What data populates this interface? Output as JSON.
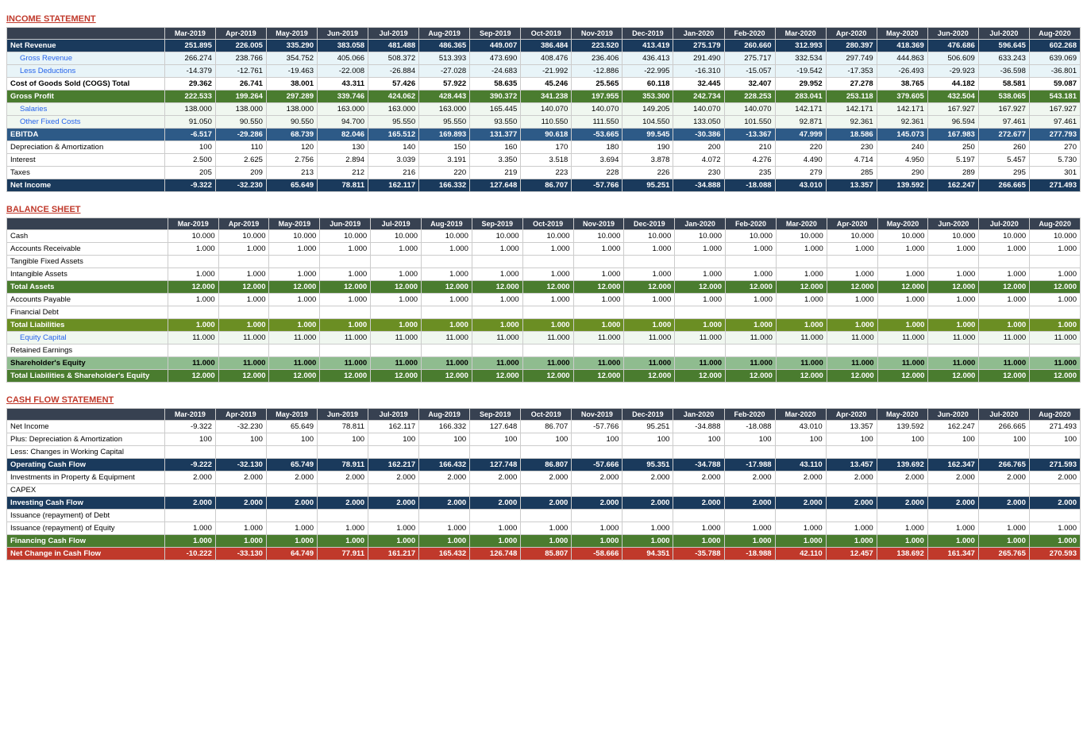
{
  "income": {
    "title": "INCOME STATEMENT",
    "columns": [
      "",
      "Mar-2019",
      "Apr-2019",
      "May-2019",
      "Jun-2019",
      "Jul-2019",
      "Aug-2019",
      "Sep-2019",
      "Oct-2019",
      "Nov-2019",
      "Dec-2019",
      "Jan-2020",
      "Feb-2020",
      "Mar-2020",
      "Apr-2020",
      "May-2020",
      "Jun-2020",
      "Jul-2020",
      "Aug-2020"
    ],
    "rows": [
      {
        "label": "Net Revenue",
        "style": "header-blue",
        "vals": [
          "251.895",
          "226.005",
          "335.290",
          "383.058",
          "481.488",
          "486.365",
          "449.007",
          "386.484",
          "223.520",
          "413.419",
          "275.179",
          "260.660",
          "312.993",
          "280.397",
          "418.369",
          "476.686",
          "596.645",
          "602.268"
        ]
      },
      {
        "label": "Gross Revenue",
        "style": "indent",
        "vals": [
          "266.274",
          "238.766",
          "354.752",
          "405.066",
          "508.372",
          "513.393",
          "473.690",
          "408.476",
          "236.406",
          "436.413",
          "291.490",
          "275.717",
          "332.534",
          "297.749",
          "444.863",
          "506.609",
          "633.243",
          "639.069"
        ]
      },
      {
        "label": "Less Deductions",
        "style": "indent",
        "vals": [
          "-14.379",
          "-12.761",
          "-19.463",
          "-22.008",
          "-26.884",
          "-27.028",
          "-24.683",
          "-21.992",
          "-12.886",
          "-22.995",
          "-16.310",
          "-15.057",
          "-19.542",
          "-17.353",
          "-26.493",
          "-29.923",
          "-36.598",
          "-36.801"
        ]
      },
      {
        "label": "Cost of Goods Sold (COGS) Total",
        "style": "cogs",
        "vals": [
          "29.362",
          "26.741",
          "38.001",
          "43.311",
          "57.426",
          "57.922",
          "58.635",
          "45.246",
          "25.565",
          "60.118",
          "32.445",
          "32.407",
          "29.952",
          "27.278",
          "38.765",
          "44.182",
          "58.581",
          "59.087"
        ]
      },
      {
        "label": "Gross Profit",
        "style": "green",
        "vals": [
          "222.533",
          "199.264",
          "297.289",
          "339.746",
          "424.062",
          "428.443",
          "390.372",
          "341.238",
          "197.955",
          "353.300",
          "242.734",
          "228.253",
          "283.041",
          "253.118",
          "379.605",
          "432.504",
          "538.065",
          "543.181"
        ]
      },
      {
        "label": "Salaries",
        "style": "indent2",
        "vals": [
          "138.000",
          "138.000",
          "138.000",
          "163.000",
          "163.000",
          "163.000",
          "165.445",
          "140.070",
          "140.070",
          "149.205",
          "140.070",
          "140.070",
          "142.171",
          "142.171",
          "142.171",
          "167.927",
          "167.927",
          "167.927"
        ]
      },
      {
        "label": "Other Fixed Costs",
        "style": "indent2",
        "vals": [
          "91.050",
          "90.550",
          "90.550",
          "94.700",
          "95.550",
          "95.550",
          "93.550",
          "110.550",
          "111.550",
          "104.550",
          "133.050",
          "101.550",
          "92.871",
          "92.361",
          "92.361",
          "96.594",
          "97.461",
          "97.461"
        ]
      },
      {
        "label": "EBITDA",
        "style": "ebitda",
        "vals": [
          "-6.517",
          "-29.286",
          "68.739",
          "82.046",
          "165.512",
          "169.893",
          "131.377",
          "90.618",
          "-53.665",
          "99.545",
          "-30.386",
          "-13.367",
          "47.999",
          "18.586",
          "145.073",
          "167.983",
          "272.677",
          "277.793"
        ]
      },
      {
        "label": "Depreciation & Amortization",
        "style": "plain",
        "vals": [
          "100",
          "110",
          "120",
          "130",
          "140",
          "150",
          "160",
          "170",
          "180",
          "190",
          "200",
          "210",
          "220",
          "230",
          "240",
          "250",
          "260",
          "270"
        ]
      },
      {
        "label": "Interest",
        "style": "plain",
        "vals": [
          "2.500",
          "2.625",
          "2.756",
          "2.894",
          "3.039",
          "3.191",
          "3.350",
          "3.518",
          "3.694",
          "3.878",
          "4.072",
          "4.276",
          "4.490",
          "4.714",
          "4.950",
          "5.197",
          "5.457",
          "5.730"
        ]
      },
      {
        "label": "Taxes",
        "style": "plain",
        "vals": [
          "205",
          "209",
          "213",
          "212",
          "216",
          "220",
          "219",
          "223",
          "228",
          "226",
          "230",
          "235",
          "279",
          "285",
          "290",
          "289",
          "295",
          "301"
        ]
      },
      {
        "label": "Net Income",
        "style": "netincome",
        "vals": [
          "-9.322",
          "-32.230",
          "65.649",
          "78.811",
          "162.117",
          "166.332",
          "127.648",
          "86.707",
          "-57.766",
          "95.251",
          "-34.888",
          "-18.088",
          "43.010",
          "13.357",
          "139.592",
          "162.247",
          "266.665",
          "271.493"
        ]
      }
    ]
  },
  "balance": {
    "title": "BALANCE SHEET",
    "columns": [
      "",
      "Mar-2019",
      "Apr-2019",
      "May-2019",
      "Jun-2019",
      "Jul-2019",
      "Aug-2019",
      "Sep-2019",
      "Oct-2019",
      "Nov-2019",
      "Dec-2019",
      "Jan-2020",
      "Feb-2020",
      "Mar-2020",
      "Apr-2020",
      "May-2020",
      "Jun-2020",
      "Jul-2020",
      "Aug-2020"
    ],
    "rows": [
      {
        "label": "Cash",
        "style": "plain",
        "vals": [
          "10.000",
          "10.000",
          "10.000",
          "10.000",
          "10.000",
          "10.000",
          "10.000",
          "10.000",
          "10.000",
          "10.000",
          "10.000",
          "10.000",
          "10.000",
          "10.000",
          "10.000",
          "10.000",
          "10.000",
          "10.000"
        ]
      },
      {
        "label": "Accounts Receivable",
        "style": "plain",
        "vals": [
          "1.000",
          "1.000",
          "1.000",
          "1.000",
          "1.000",
          "1.000",
          "1.000",
          "1.000",
          "1.000",
          "1.000",
          "1.000",
          "1.000",
          "1.000",
          "1.000",
          "1.000",
          "1.000",
          "1.000",
          "1.000"
        ]
      },
      {
        "label": "Tangible Fixed Assets",
        "style": "plain",
        "vals": [
          "",
          "",
          "",
          "",
          "",
          "",
          "",
          "",
          "",
          "",
          "",
          "",
          "",
          "",
          "",
          "",
          "",
          ""
        ]
      },
      {
        "label": "Intangible Assets",
        "style": "plain",
        "vals": [
          "1.000",
          "1.000",
          "1.000",
          "1.000",
          "1.000",
          "1.000",
          "1.000",
          "1.000",
          "1.000",
          "1.000",
          "1.000",
          "1.000",
          "1.000",
          "1.000",
          "1.000",
          "1.000",
          "1.000",
          "1.000"
        ]
      },
      {
        "label": "Total Assets",
        "style": "total-assets",
        "vals": [
          "12.000",
          "12.000",
          "12.000",
          "12.000",
          "12.000",
          "12.000",
          "12.000",
          "12.000",
          "12.000",
          "12.000",
          "12.000",
          "12.000",
          "12.000",
          "12.000",
          "12.000",
          "12.000",
          "12.000",
          "12.000"
        ]
      },
      {
        "label": "Accounts Payable",
        "style": "plain",
        "vals": [
          "1.000",
          "1.000",
          "1.000",
          "1.000",
          "1.000",
          "1.000",
          "1.000",
          "1.000",
          "1.000",
          "1.000",
          "1.000",
          "1.000",
          "1.000",
          "1.000",
          "1.000",
          "1.000",
          "1.000",
          "1.000"
        ]
      },
      {
        "label": "Financial Debt",
        "style": "plain",
        "vals": [
          "",
          "",
          "",
          "",
          "",
          "",
          "",
          "",
          "",
          "",
          "",
          "",
          "",
          "",
          "",
          "",
          "",
          ""
        ]
      },
      {
        "label": "Total Liabilities",
        "style": "total-liab",
        "vals": [
          "1.000",
          "1.000",
          "1.000",
          "1.000",
          "1.000",
          "1.000",
          "1.000",
          "1.000",
          "1.000",
          "1.000",
          "1.000",
          "1.000",
          "1.000",
          "1.000",
          "1.000",
          "1.000",
          "1.000",
          "1.000"
        ]
      },
      {
        "label": "Equity Capital",
        "style": "indent2",
        "vals": [
          "11.000",
          "11.000",
          "11.000",
          "11.000",
          "11.000",
          "11.000",
          "11.000",
          "11.000",
          "11.000",
          "11.000",
          "11.000",
          "11.000",
          "11.000",
          "11.000",
          "11.000",
          "11.000",
          "11.000",
          "11.000"
        ]
      },
      {
        "label": "Retained Earnings",
        "style": "plain",
        "vals": [
          "",
          "",
          "",
          "",
          "",
          "",
          "",
          "",
          "",
          "",
          "",
          "",
          "",
          "",
          "",
          "",
          "",
          ""
        ]
      },
      {
        "label": "Shareholder's Equity",
        "style": "shareholder",
        "vals": [
          "11.000",
          "11.000",
          "11.000",
          "11.000",
          "11.000",
          "11.000",
          "11.000",
          "11.000",
          "11.000",
          "11.000",
          "11.000",
          "11.000",
          "11.000",
          "11.000",
          "11.000",
          "11.000",
          "11.000",
          "11.000"
        ]
      },
      {
        "label": "Total Liabilities & Shareholder's Equity",
        "style": "total-ls",
        "vals": [
          "12.000",
          "12.000",
          "12.000",
          "12.000",
          "12.000",
          "12.000",
          "12.000",
          "12.000",
          "12.000",
          "12.000",
          "12.000",
          "12.000",
          "12.000",
          "12.000",
          "12.000",
          "12.000",
          "12.000",
          "12.000"
        ]
      }
    ]
  },
  "cashflow": {
    "title": "CASH FLOW STATEMENT",
    "columns": [
      "",
      "Mar-2019",
      "Apr-2019",
      "May-2019",
      "Jun-2019",
      "Jul-2019",
      "Aug-2019",
      "Sep-2019",
      "Oct-2019",
      "Nov-2019",
      "Dec-2019",
      "Jan-2020",
      "Feb-2020",
      "Mar-2020",
      "Apr-2020",
      "May-2020",
      "Jun-2020",
      "Jul-2020",
      "Aug-2020"
    ],
    "rows": [
      {
        "label": "Net Income",
        "style": "plain",
        "vals": [
          "-9.322",
          "-32.230",
          "65.649",
          "78.811",
          "162.117",
          "166.332",
          "127.648",
          "86.707",
          "-57.766",
          "95.251",
          "-34.888",
          "-18.088",
          "43.010",
          "13.357",
          "139.592",
          "162.247",
          "266.665",
          "271.493"
        ]
      },
      {
        "label": "Plus: Depreciation & Amortization",
        "style": "plain",
        "vals": [
          "100",
          "100",
          "100",
          "100",
          "100",
          "100",
          "100",
          "100",
          "100",
          "100",
          "100",
          "100",
          "100",
          "100",
          "100",
          "100",
          "100",
          "100"
        ]
      },
      {
        "label": "Less: Changes in Working Capital",
        "style": "plain",
        "vals": [
          "",
          "",
          "",
          "",
          "",
          "",
          "",
          "",
          "",
          "",
          "",
          "",
          "",
          "",
          "",
          "",
          "",
          ""
        ]
      },
      {
        "label": "Operating Cash Flow",
        "style": "operating",
        "vals": [
          "-9.222",
          "-32.130",
          "65.749",
          "78.911",
          "162.217",
          "166.432",
          "127.748",
          "86.807",
          "-57.666",
          "95.351",
          "-34.788",
          "-17.988",
          "43.110",
          "13.457",
          "139.692",
          "162.347",
          "266.765",
          "271.593"
        ]
      },
      {
        "label": "Investments in Property & Equipment",
        "style": "plain",
        "vals": [
          "2.000",
          "2.000",
          "2.000",
          "2.000",
          "2.000",
          "2.000",
          "2.000",
          "2.000",
          "2.000",
          "2.000",
          "2.000",
          "2.000",
          "2.000",
          "2.000",
          "2.000",
          "2.000",
          "2.000",
          "2.000"
        ]
      },
      {
        "label": "CAPEX",
        "style": "plain",
        "vals": [
          "",
          "",
          "",
          "",
          "",
          "",
          "",
          "",
          "",
          "",
          "",
          "",
          "",
          "",
          "",
          "",
          "",
          ""
        ]
      },
      {
        "label": "Investing Cash Flow",
        "style": "investing",
        "vals": [
          "2.000",
          "2.000",
          "2.000",
          "2.000",
          "2.000",
          "2.000",
          "2.000",
          "2.000",
          "2.000",
          "2.000",
          "2.000",
          "2.000",
          "2.000",
          "2.000",
          "2.000",
          "2.000",
          "2.000",
          "2.000"
        ]
      },
      {
        "label": "Issuance (repayment) of Debt",
        "style": "plain",
        "vals": [
          "",
          "",
          "",
          "",
          "",
          "",
          "",
          "",
          "",
          "",
          "",
          "",
          "",
          "",
          "",
          "",
          "",
          ""
        ]
      },
      {
        "label": "Issuance (repayment) of Equity",
        "style": "plain",
        "vals": [
          "1.000",
          "1.000",
          "1.000",
          "1.000",
          "1.000",
          "1.000",
          "1.000",
          "1.000",
          "1.000",
          "1.000",
          "1.000",
          "1.000",
          "1.000",
          "1.000",
          "1.000",
          "1.000",
          "1.000",
          "1.000"
        ]
      },
      {
        "label": "Financing Cash Flow",
        "style": "financing",
        "vals": [
          "1.000",
          "1.000",
          "1.000",
          "1.000",
          "1.000",
          "1.000",
          "1.000",
          "1.000",
          "1.000",
          "1.000",
          "1.000",
          "1.000",
          "1.000",
          "1.000",
          "1.000",
          "1.000",
          "1.000",
          "1.000"
        ]
      },
      {
        "label": "Net Change in Cash Flow",
        "style": "netchange",
        "vals": [
          "-10.222",
          "-33.130",
          "64.749",
          "77.911",
          "161.217",
          "165.432",
          "126.748",
          "85.807",
          "-58.666",
          "94.351",
          "-35.788",
          "-18.988",
          "42.110",
          "12.457",
          "138.692",
          "161.347",
          "265.765",
          "270.593"
        ]
      }
    ]
  }
}
